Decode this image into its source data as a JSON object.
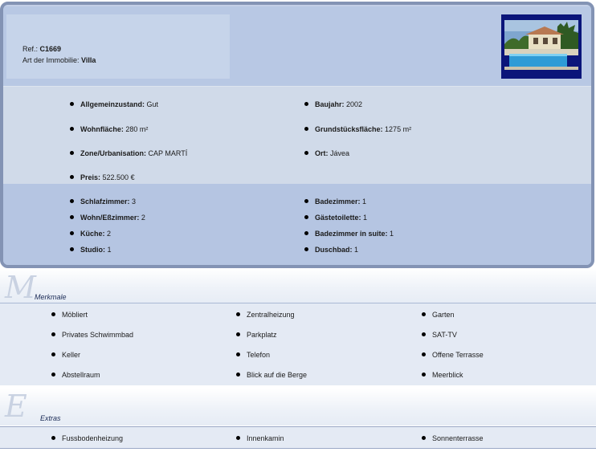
{
  "header": {
    "ref_label": "Ref.:",
    "ref_value": "C1669",
    "type_label": "Art der Immobilie:",
    "type_value": "Villa",
    "photo_icon": "villa-pool-photo"
  },
  "details": [
    {
      "label": "Allgemeinzustand:",
      "value": "Gut"
    },
    {
      "label": "Baujahr:",
      "value": "2002"
    },
    {
      "label": "Wohnfläche:",
      "value": "280 m²"
    },
    {
      "label": "Grundstücksfläche:",
      "value": "1275 m²"
    },
    {
      "label": "Zone/Urbanisation:",
      "value": "CAP MARTÍ"
    },
    {
      "label": "Ort:",
      "value": "Jávea"
    },
    {
      "label": "Preis:",
      "value": "522.500 €"
    }
  ],
  "rooms": [
    {
      "label": "Schlafzimmer:",
      "value": "3"
    },
    {
      "label": "Badezimmer:",
      "value": "1"
    },
    {
      "label": "Wohn/Eßzimmer:",
      "value": "2"
    },
    {
      "label": "Gästetoilette:",
      "value": "1"
    },
    {
      "label": "Küche:",
      "value": "2"
    },
    {
      "label": "Badezimmer in suite:",
      "value": "1"
    },
    {
      "label": "Studio:",
      "value": "1"
    },
    {
      "label": "Duschbad:",
      "value": "1"
    }
  ],
  "merkmale": {
    "letter": "M",
    "title": "Merkmale",
    "items": [
      "Möbliert",
      "Zentralheizung",
      "Garten",
      "Privates Schwimmbad",
      "Parkplatz",
      "SAT-TV",
      "Keller",
      "Telefon",
      "Offene Terrasse",
      "Abstellraum",
      "Blick auf die Berge",
      "Meerblick"
    ]
  },
  "extras": {
    "letter": "E",
    "title": "Extras",
    "items": [
      "Fussbodenheizung",
      "Innenkamin",
      "Sonnenterrasse"
    ]
  }
}
